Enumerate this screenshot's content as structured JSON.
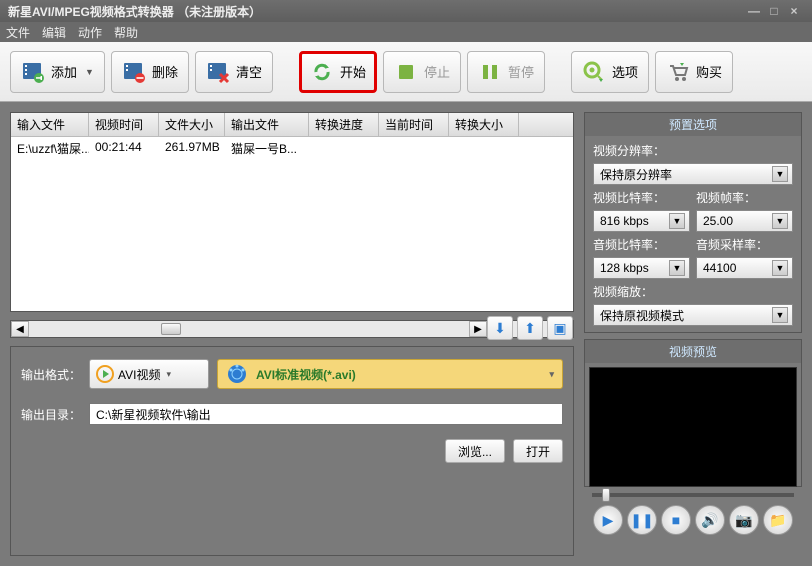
{
  "title": "新星AVI/MPEG视频格式转换器  （未注册版本）",
  "menu": {
    "file": "文件",
    "edit": "编辑",
    "action": "动作",
    "help": "帮助"
  },
  "toolbar": {
    "add": "添加",
    "delete": "删除",
    "clear": "清空",
    "start": "开始",
    "stop": "停止",
    "pause": "暂停",
    "options": "选项",
    "buy": "购买"
  },
  "table": {
    "h0": "输入文件",
    "h1": "视频时间",
    "h2": "文件大小",
    "h3": "输出文件",
    "h4": "转换进度",
    "h5": "当前时间",
    "h6": "转换大小",
    "r0": {
      "c0": "E:\\uzzf\\猫屎...",
      "c1": "00:21:44",
      "c2": "261.97MB",
      "c3": "猫屎一号B..."
    }
  },
  "output": {
    "format_label": "输出格式：",
    "format_value": "AVI视频",
    "profile_value": "AVI标准视频(*.avi)",
    "dir_label": "输出目录：",
    "dir_value": "C:\\新星视频软件\\输出",
    "browse": "浏览...",
    "open": "打开"
  },
  "preset": {
    "title": "预置选项",
    "res_label": "视频分辨率：",
    "res_value": "保持原分辨率",
    "vbr_label": "视频比特率：",
    "vbr_value": "816 kbps",
    "fps_label": "视频帧率：",
    "fps_value": "25.00",
    "abr_label": "音频比特率：",
    "abr_value": "128 kbps",
    "sr_label": "音频采样率：",
    "sr_value": "44100",
    "scale_label": "视频缩放：",
    "scale_value": "保持原视频模式"
  },
  "preview": {
    "title": "视频预览"
  }
}
